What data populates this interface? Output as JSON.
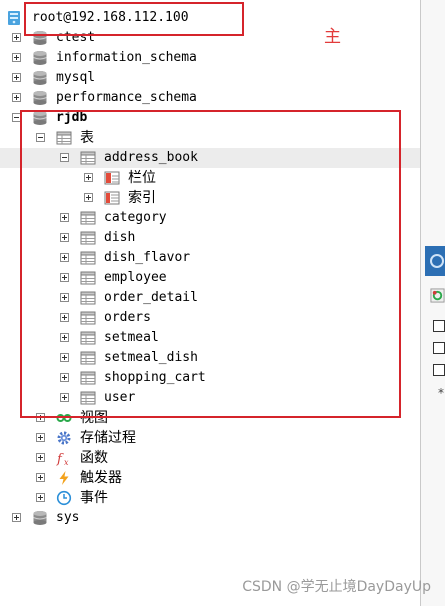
{
  "connection": {
    "label": "root@192.168.112.100"
  },
  "annotation": {
    "main_label": "主"
  },
  "tree": {
    "databases": [
      {
        "name": "ctest",
        "expanded": false
      },
      {
        "name": "information_schema",
        "expanded": false
      },
      {
        "name": "mysql",
        "expanded": false
      },
      {
        "name": "performance_schema",
        "expanded": false
      },
      {
        "name": "rjdb",
        "expanded": true
      },
      {
        "name": "sys",
        "expanded": false
      }
    ],
    "rjdb": {
      "tables_folder": "表",
      "tables": [
        "address_book",
        "category",
        "dish",
        "dish_flavor",
        "employee",
        "order_detail",
        "orders",
        "setmeal",
        "setmeal_dish",
        "shopping_cart",
        "user"
      ],
      "address_book_children": [
        "栏位",
        "索引"
      ],
      "views": "视图",
      "procedures": "存储过程",
      "functions": "函数",
      "triggers": "触发器",
      "events": "事件"
    }
  },
  "watermark": "CSDN @学无止境DayDayUp",
  "colors": {
    "annotation": "#d5242b",
    "selection": "#ececec",
    "side_header": "#2c6fb4"
  },
  "icons": {
    "database": "database-icon",
    "table": "table-icon",
    "view": "view-icon",
    "procedure": "gear-icon",
    "function": "function-icon",
    "trigger": "lightning-icon",
    "event": "clock-icon",
    "server": "server-icon"
  }
}
